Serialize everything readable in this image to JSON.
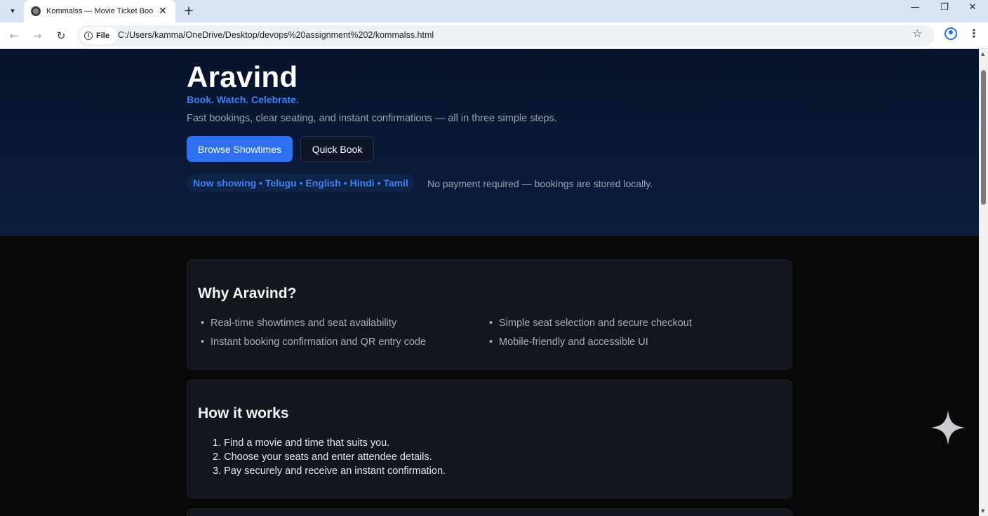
{
  "browser": {
    "tab_title": "Kommalss — Movie Ticket Booking",
    "tab_close": "✕",
    "new_tab": "+",
    "window_controls": {
      "minimize": "—",
      "maximize": "❐",
      "close": "✕"
    },
    "nav": {
      "back": "←",
      "forward": "→",
      "reload": "↻"
    },
    "site_chip": "File",
    "url": "C:/Users/kamma/OneDrive/Desktop/devops%20assignment%202/kommalss.html",
    "icons": [
      "chevron-down-icon",
      "globe-icon",
      "close-icon",
      "plus-icon",
      "info-icon",
      "star-icon",
      "profile-icon",
      "more-menu-icon",
      "sparkle-icon"
    ]
  },
  "hero": {
    "brand": "Aravind",
    "tagline": "Book. Watch. Celebrate.",
    "subtitle": "Fast bookings, clear seating, and instant confirmations — all in three simple steps.",
    "primary_button": "Browse Showtimes",
    "secondary_button": "Quick Book",
    "now_showing": "Now showing • Telugu • English • Hindi • Tamil",
    "note": "No payment required — bookings are stored locally.",
    "accent_color": "#3b82f6"
  },
  "why": {
    "title": "Why Aravind?",
    "features": [
      "Real-time showtimes and seat availability",
      "Instant booking confirmation and QR entry code",
      "Simple seat selection and secure checkout",
      "Mobile-friendly and accessible UI"
    ]
  },
  "how": {
    "title": "How it works",
    "steps": [
      "1. Find a movie and time that suits you.",
      "2. Choose your seats and enter attendee details.",
      "3. Pay securely and receive an instant confirmation."
    ]
  }
}
